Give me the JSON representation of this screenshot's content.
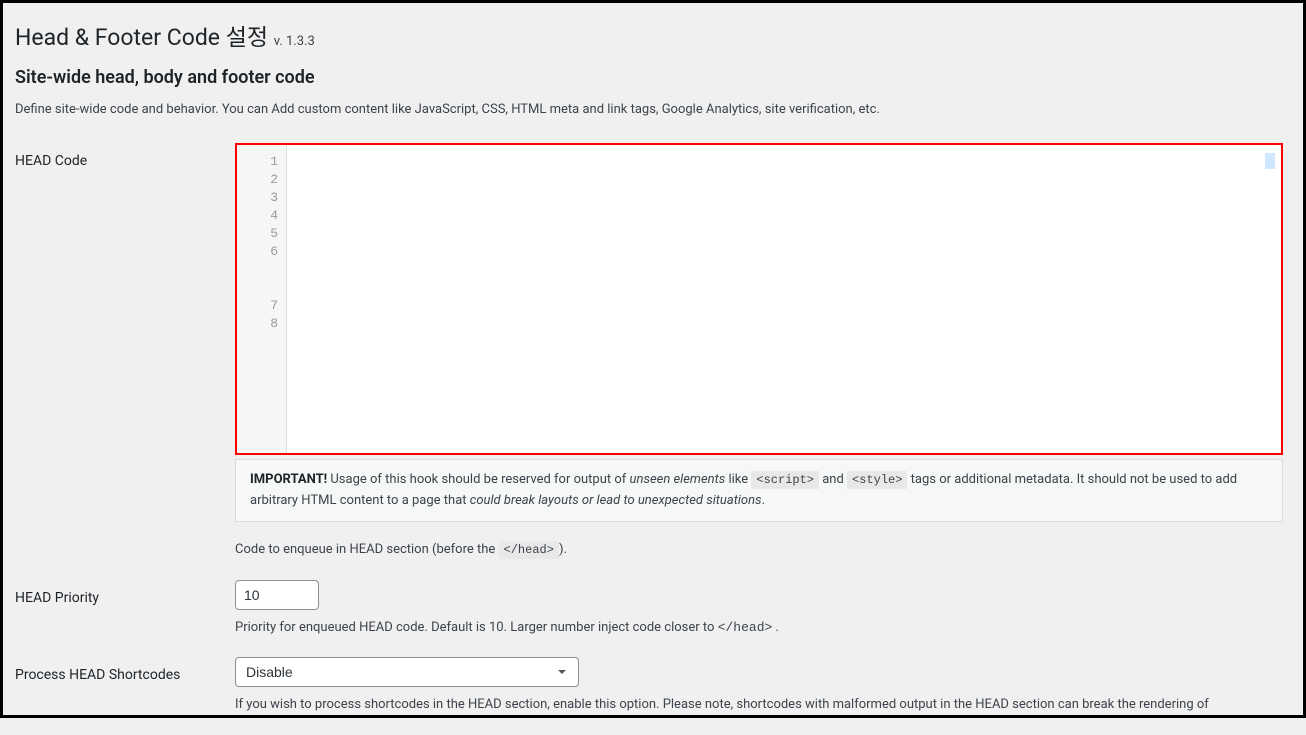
{
  "page": {
    "title": "Head & Footer Code 설정",
    "version": "v. 1.3.3"
  },
  "section": {
    "title": "Site-wide head, body and footer code",
    "desc": "Define site-wide code and behavior. You can Add custom content like JavaScript, CSS, HTML meta and link tags, Google Analytics, site verification, etc."
  },
  "fields": {
    "head_code": {
      "label": "HEAD Code",
      "line_numbers": [
        "1",
        "2",
        "3",
        "4",
        "5",
        "6",
        "7",
        "8"
      ],
      "note_bold": "IMPORTANT!",
      "note_p1": " Usage of this hook should be reserved for output of ",
      "note_em1": "unseen elements",
      "note_p2": " like ",
      "note_code1": "<script>",
      "note_p3": " and ",
      "note_code2": "<style>",
      "note_p4": " tags or additional metadata. It should not be used to add arbitrary HTML content to a page that ",
      "note_em2": "could break layouts or lead to unexpected situations",
      "note_p5": ".",
      "help_p1": "Code to enqueue in HEAD section (before the ",
      "help_code": "</head>",
      "help_p2": ")."
    },
    "head_priority": {
      "label": "HEAD Priority",
      "value": "10",
      "help_p1": "Priority for enqueued HEAD code. Default is 10. Larger number inject code closer to ",
      "help_code": "</head>",
      "help_p2": " ."
    },
    "head_shortcodes": {
      "label": "Process HEAD Shortcodes",
      "selected": "Disable",
      "help": "If you wish to process shortcodes in the HEAD section, enable this option. Please note, shortcodes with malformed output in the HEAD section can break the rendering of"
    }
  }
}
